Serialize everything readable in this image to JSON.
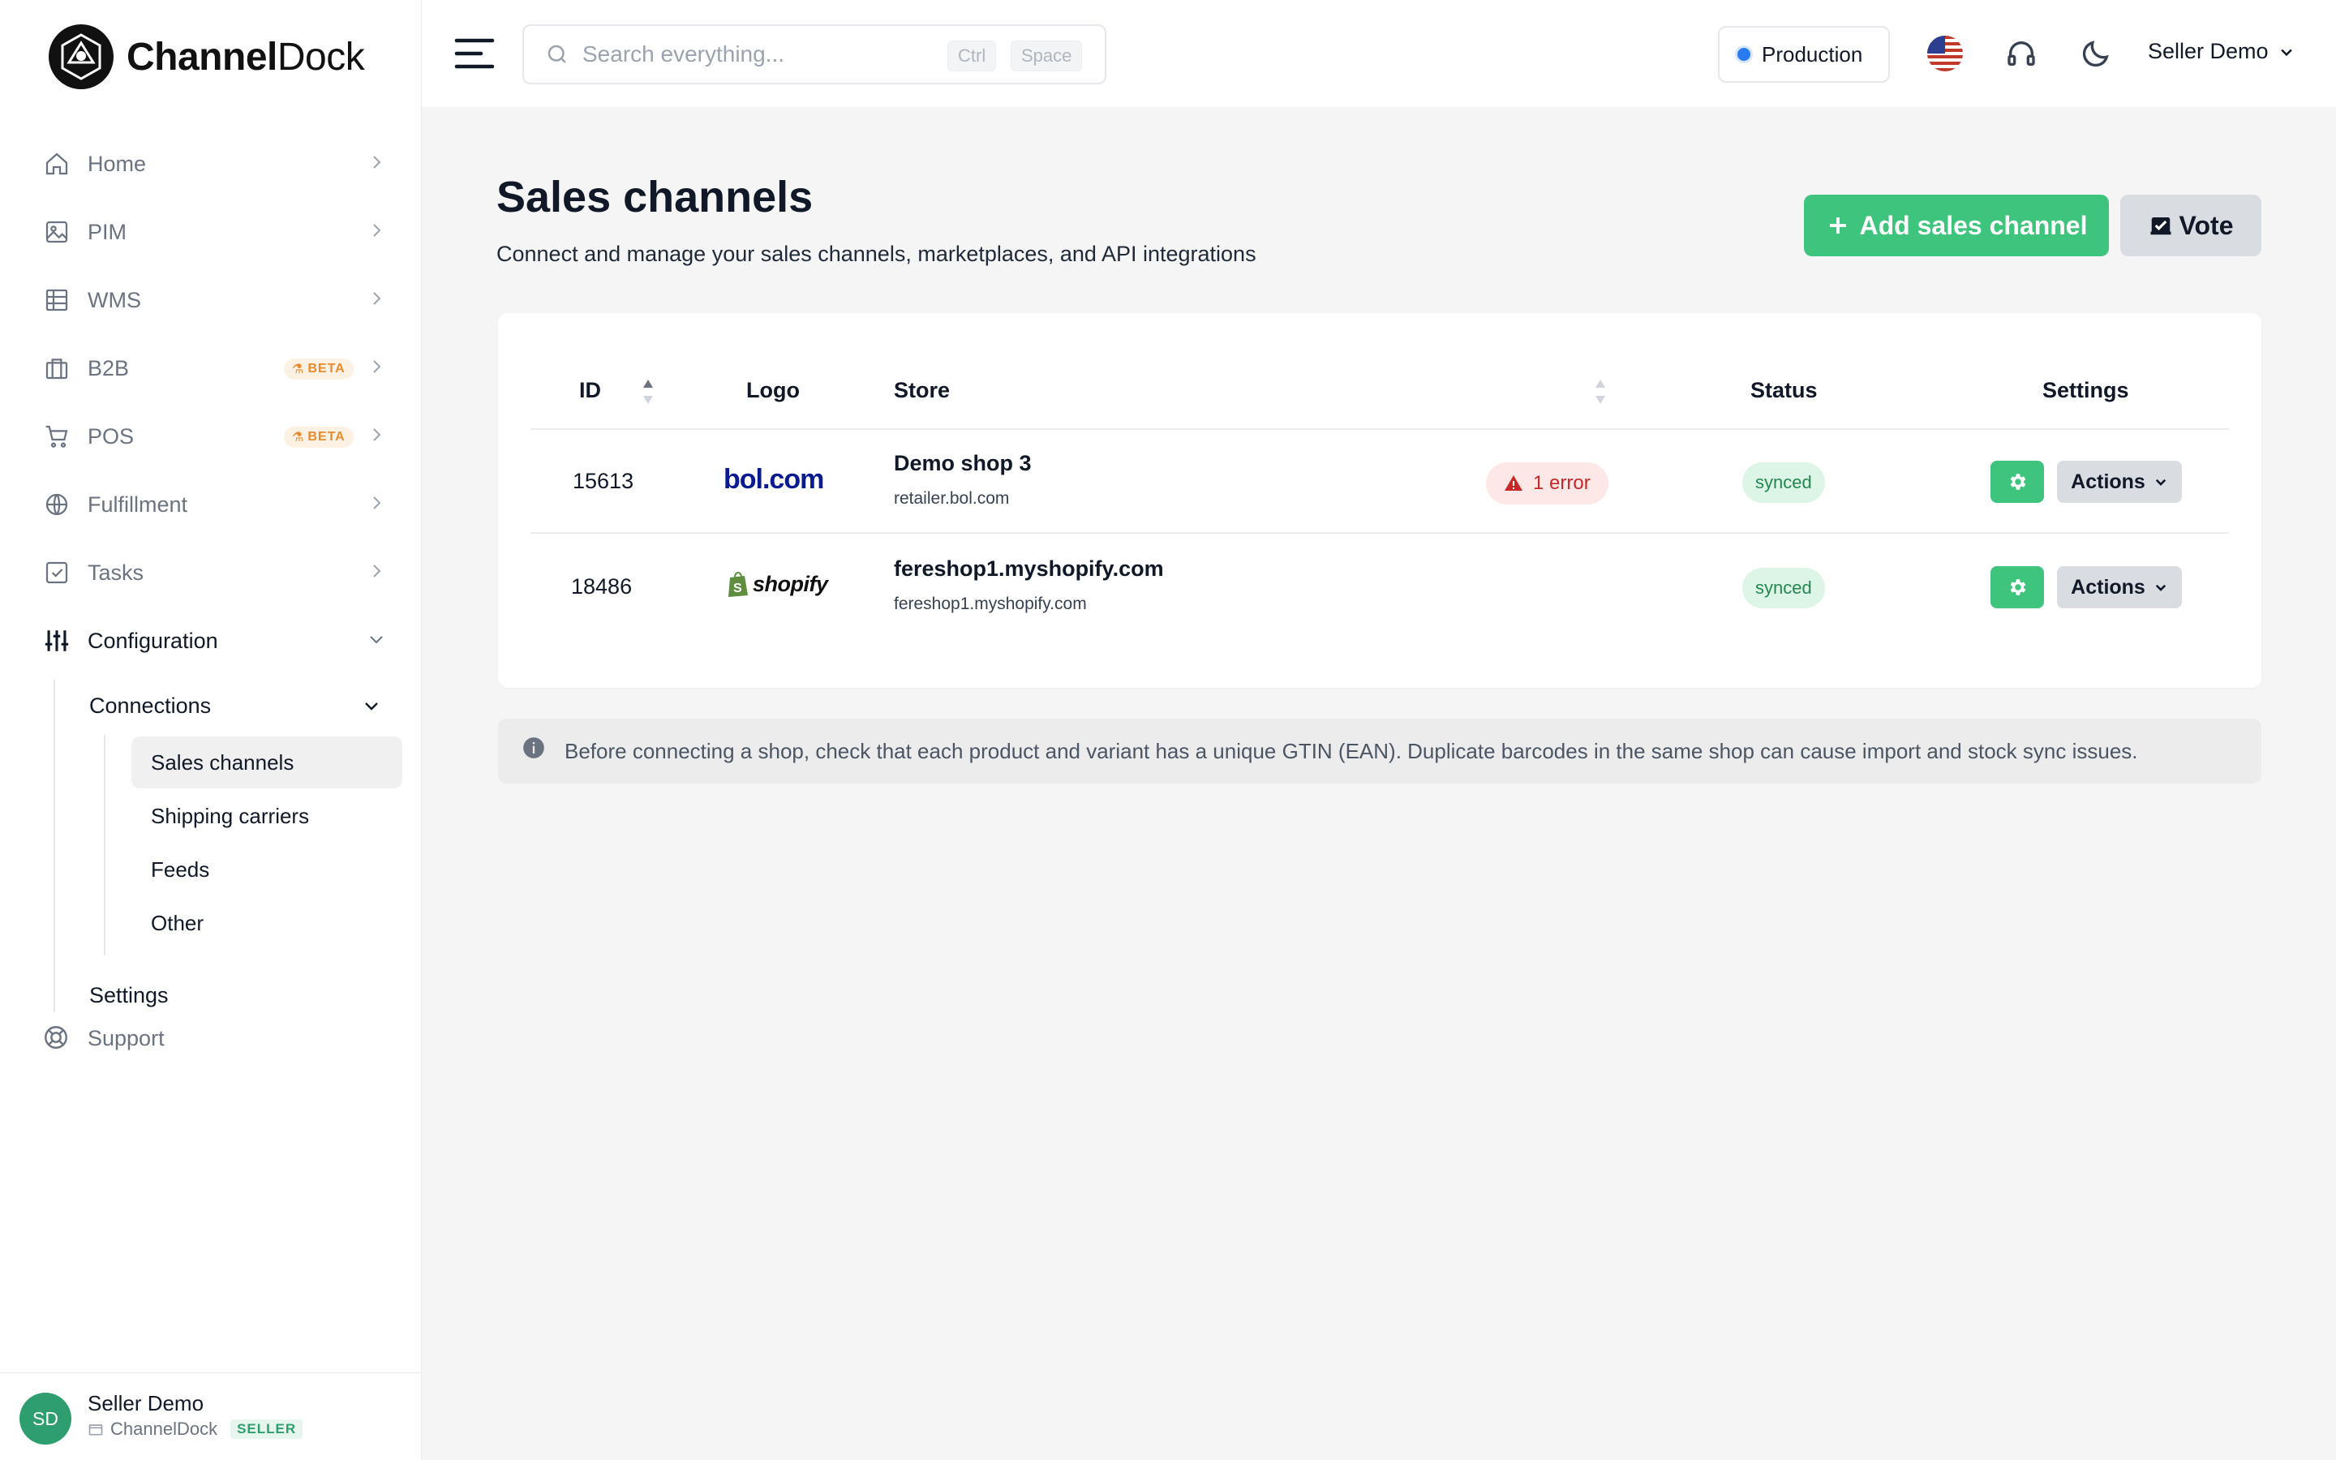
{
  "brand": {
    "name_bold": "Channel",
    "name_regular": "Dock"
  },
  "sidebar": {
    "items": [
      {
        "label": "Home",
        "icon": "home-icon"
      },
      {
        "label": "PIM",
        "icon": "image-icon"
      },
      {
        "label": "WMS",
        "icon": "table-icon"
      },
      {
        "label": "B2B",
        "icon": "briefcase-icon",
        "badge": "BETA"
      },
      {
        "label": "POS",
        "icon": "cart-icon",
        "badge": "BETA"
      },
      {
        "label": "Fulfillment",
        "icon": "globe-icon"
      },
      {
        "label": "Tasks",
        "icon": "checkbox-icon"
      },
      {
        "label": "Configuration",
        "icon": "sliders-icon"
      }
    ],
    "connections_label": "Connections",
    "connections_children": [
      "Sales channels",
      "Shipping carriers",
      "Feeds",
      "Other"
    ],
    "settings_label": "Settings",
    "support_label": "Support",
    "user": {
      "initials": "SD",
      "name": "Seller Demo",
      "company": "ChannelDock",
      "role": "SELLER"
    }
  },
  "topbar": {
    "search_placeholder": "Search everything...",
    "shortcut_keys": [
      "Ctrl",
      "Space"
    ],
    "environment": "Production",
    "user_menu": "Seller Demo"
  },
  "page": {
    "title": "Sales channels",
    "subtitle": "Connect and manage your sales channels, marketplaces, and API integrations",
    "add_button": "Add sales channel",
    "vote_button": "Vote"
  },
  "table": {
    "headers": {
      "id": "ID",
      "logo": "Logo",
      "store": "Store",
      "status": "Status",
      "settings": "Settings"
    },
    "rows": [
      {
        "id": "15613",
        "logo": "bol.com",
        "store_name": "Demo shop 3",
        "store_url": "retailer.bol.com",
        "error": "1 error",
        "status": "synced",
        "actions": "Actions"
      },
      {
        "id": "18486",
        "logo": "shopify",
        "store_name": "fereshop1.myshopify.com",
        "store_url": "fereshop1.myshopify.com",
        "status": "synced",
        "actions": "Actions"
      }
    ]
  },
  "notice": "Before connecting a shop, check that each product and variant has a unique GTIN (EAN). Duplicate barcodes in the same shop can cause import and stock sync issues.",
  "colors": {
    "accent_green": "#3ec47d",
    "error_red": "#c62828",
    "env_blue": "#2b7bf0"
  }
}
